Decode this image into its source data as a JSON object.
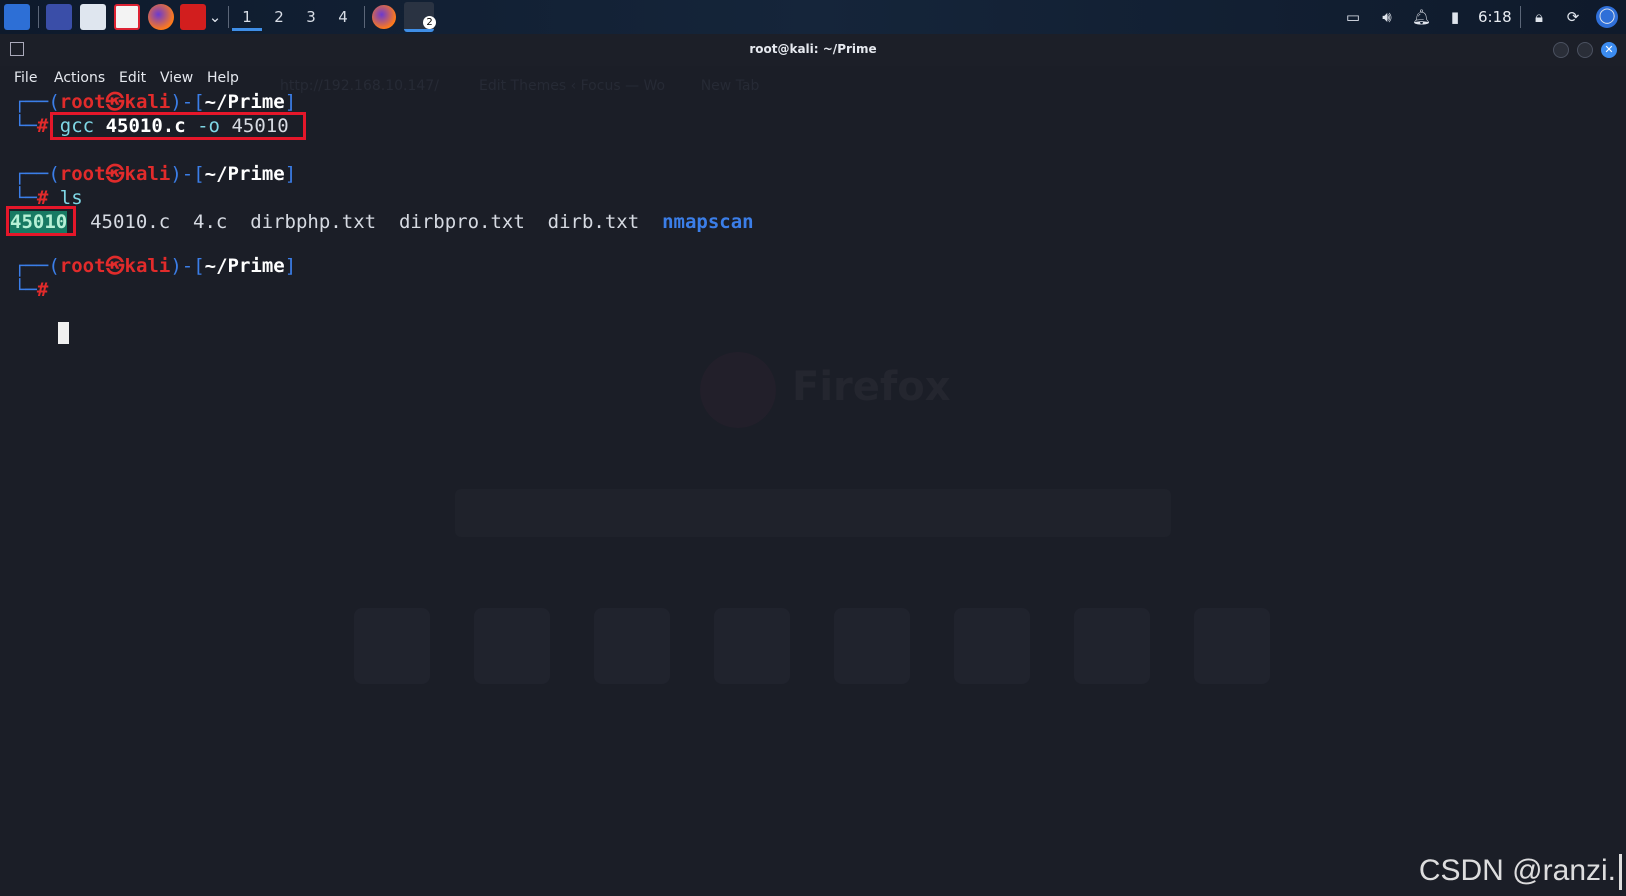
{
  "taskbar": {
    "workspaces": [
      "1",
      "2",
      "3",
      "4"
    ],
    "active_workspace": "1",
    "terminal_badge": "2",
    "clock": "6:18",
    "icons": [
      "kali-menu-icon",
      "desktop-icon",
      "file-manager-icon",
      "text-editor-icon",
      "firefox-icon",
      "terminal-red-icon",
      "chevron-down-icon",
      "firefox-icon",
      "terminal-icon",
      "screen-icon",
      "volume-icon",
      "bell-icon",
      "battery-icon",
      "lock-icon",
      "refresh-icon",
      "power-icon"
    ]
  },
  "window": {
    "title": "root@kali: ~/Prime",
    "menu": [
      "File",
      "Actions",
      "Edit",
      "View",
      "Help"
    ]
  },
  "terminal": {
    "prompt": {
      "open": "┌──(",
      "user": "root",
      "at": "㉿",
      "host": "kali",
      "mid": ")-[",
      "dir": "~/Prime",
      "close": "]",
      "corner": "└─",
      "hash": "#"
    },
    "cmd1": {
      "prog": "gcc",
      "file": "45010.c",
      "flag": "-o",
      "out": "45010"
    },
    "cmd2": "ls",
    "ls_output": {
      "exec": "45010",
      "files": "45010.c  4.c  dirbphp.txt  dirbpro.txt  dirb.txt",
      "dir": "nmapscan"
    }
  },
  "colors": {
    "prompt_blue": "#3b7ee8",
    "root_red": "#e12b2b",
    "highlight": "#e5172a",
    "dir_blue": "#3b7ee8"
  },
  "watermark": "CSDN @ranzi."
}
